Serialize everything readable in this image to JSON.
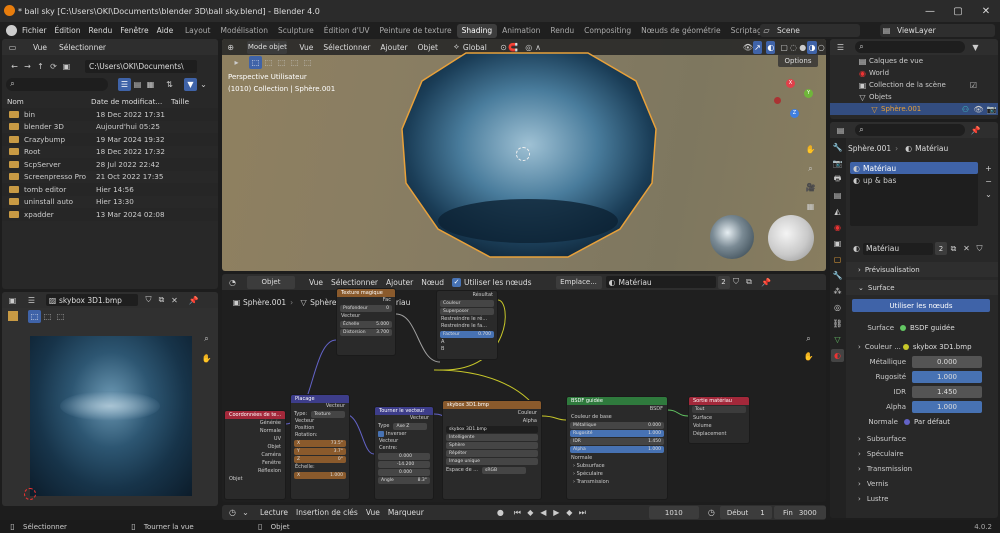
{
  "app": {
    "title": "* ball sky [C:\\Users\\OKI\\Documents\\blender 3D\\ball sky.blend] - Blender 4.0",
    "version": "4.0.2"
  },
  "menu": {
    "items": [
      "Fichier",
      "Édition",
      "Rendu",
      "Fenêtre",
      "Aide"
    ],
    "workspaces": [
      "Layout",
      "Modélisation",
      "Sculpture",
      "Édition d'UV",
      "Peinture de texture",
      "Shading",
      "Animation",
      "Rendu",
      "Compositing",
      "Nœuds de géométrie",
      "Scriptage"
    ],
    "active_workspace": "Shading",
    "scene": "Scene",
    "view_layer": "ViewLayer"
  },
  "file_browser": {
    "menu": [
      "Vue",
      "Sélectionner"
    ],
    "path": "C:\\Users\\OKI\\Documents\\",
    "columns": [
      "Nom",
      "Date de modificat...",
      "Taille"
    ],
    "files": [
      {
        "name": "bin",
        "date": "18 Dec 2022 17:31"
      },
      {
        "name": "blender 3D",
        "date": "Aujourd'hui 05:25"
      },
      {
        "name": "Crazybump",
        "date": "19 Mar 2024 19:32"
      },
      {
        "name": "Root",
        "date": "18 Dec 2022 17:32"
      },
      {
        "name": "ScpServer",
        "date": "28 Jul 2022 22:42"
      },
      {
        "name": "Screenpresso Pro",
        "date": "21 Oct 2022 17:35"
      },
      {
        "name": "tomb editor",
        "date": "Hier 14:56"
      },
      {
        "name": "uninstall auto",
        "date": "Hier 13:30"
      },
      {
        "name": "xpadder",
        "date": "13 Mar 2024 02:08"
      }
    ]
  },
  "image_editor": {
    "image_name": "skybox 3D1.bmp"
  },
  "viewport": {
    "mode": "Mode objet",
    "menu": [
      "Vue",
      "Sélectionner",
      "Ajouter",
      "Objet"
    ],
    "transform": "Global",
    "info_line1": "Perspective Utilisateur",
    "info_line2": "(1010) Collection | Sphère.001",
    "options": "Options",
    "axes": {
      "x": "X",
      "y": "Y",
      "z": "Z"
    }
  },
  "node_editor": {
    "type": "Objet",
    "menu": [
      "Vue",
      "Sélectionner",
      "Ajouter",
      "Nœud"
    ],
    "use_nodes_label": "Utiliser les nœuds",
    "slot": "Emplace...",
    "material": "Matériau",
    "users": "2",
    "breadcrumb": [
      "Sphère.001",
      "Sphère.001",
      "Matériau"
    ],
    "nodes": {
      "mix": {
        "out": "Résultat",
        "type": "Couleur",
        "blend": "Superposer",
        "clamp1": "Restreindre le ré...",
        "clamp2": "Restreindre le fa...",
        "factor_label": "Facteur",
        "factor": "0.700",
        "a": "A",
        "b": "B"
      },
      "magic": {
        "title": "Texture magique",
        "out": "Fac",
        "depth_label": "Profondeur",
        "depth": "0",
        "vec": "Vecteur",
        "scale_label": "Échelle",
        "scale": "5.000",
        "distortion_label": "Distorsion",
        "distortion": "3.700"
      },
      "coords": {
        "title": "Coordonnées de te...",
        "outs": [
          "Générée",
          "Normale",
          "UV",
          "Objet",
          "Caméra",
          "Fenêtre",
          "Réflexion"
        ],
        "object_label": "Objet"
      },
      "mapping": {
        "title": "Placage",
        "out": "Vecteur",
        "type_label": "Type:",
        "type": "Texture",
        "vec": "Vecteur",
        "position": "Position",
        "rotation": "Rotation:",
        "rx_label": "X",
        "rx": "73.5°",
        "ry_label": "Y",
        "ry": "3.7°",
        "rz_label": "Z",
        "rz": "0°",
        "scale": "Échelle:",
        "sx_label": "X",
        "sx": "1.000"
      },
      "rotate": {
        "title": "Tourner le vecteur",
        "out": "Vecteur",
        "type_label": "Type",
        "type": "Axe Z",
        "invert": "Inverser",
        "vec": "Vecteur",
        "center": "Centre:",
        "cx": "0.000",
        "cy": "-14.200",
        "cz": "0.000",
        "angle_label": "Angle",
        "angle": "8.3°"
      },
      "image": {
        "title": "skybox 3D1.bmp",
        "outs": [
          "Couleur",
          "Alpha"
        ],
        "img": "skybox 3D1.bmp",
        "interp": "Intelligente",
        "proj": "Sphère",
        "ext": "Répéter",
        "source": "Image unique",
        "cs_label": "Espace de ...",
        "cs": "sRGB"
      },
      "bsdf": {
        "title": "BSDF guidée",
        "out": "BSDF",
        "base": "Couleur de base",
        "metal_label": "Métallique",
        "metal": "0.000",
        "rough_label": "Rugosité",
        "rough": "1.000",
        "ior_label": "IDR",
        "ior": "1.450",
        "alpha_label": "Alpha",
        "alpha": "1.000",
        "normal": "Normale",
        "sub": "Subsurface",
        "spec": "Spéculaire",
        "trans": "Transmission"
      },
      "output": {
        "title": "Sortie matériau",
        "target": "Tout",
        "surface": "Surface",
        "volume": "Volume",
        "disp": "Déplacement"
      }
    }
  },
  "outliner": {
    "items": [
      {
        "label": "Calques de vue"
      },
      {
        "label": "World"
      },
      {
        "label": "Collection de la scène"
      },
      {
        "label": "Objets"
      },
      {
        "label": "Sphère.001"
      }
    ]
  },
  "properties": {
    "object": "Sphère.001",
    "material": "Matériau",
    "slots": [
      "Matériau",
      "up & bas"
    ],
    "mat_name": "Matériau",
    "mat_users": "2",
    "preview": "Prévisualisation",
    "surface_section": "Surface",
    "use_nodes": "Utiliser les nœuds",
    "surface_label": "Surface",
    "surface_value": "BSDF guidée",
    "color_label": "Couleur ...",
    "color_value": "skybox 3D1.bmp",
    "metal_label": "Métallique",
    "metal": "0.000",
    "rough_label": "Rugosité",
    "rough": "1.000",
    "ior_label": "IDR",
    "ior": "1.450",
    "alpha_label": "Alpha",
    "alpha": "1.000",
    "normal_label": "Normale",
    "normal_value": "Par défaut",
    "subsections": [
      "Subsurface",
      "Spéculaire",
      "Transmission",
      "Vernis",
      "Lustre"
    ]
  },
  "timeline": {
    "menu": [
      "Lecture",
      "Insertion de clés",
      "Vue",
      "Marqueur"
    ],
    "current_frame": "1010",
    "start_label": "Début",
    "start": "1",
    "end_label": "Fin",
    "end": "3000"
  },
  "statusbar": {
    "select": "Sélectionner",
    "rotate": "Tourner la vue",
    "object": "Objet"
  }
}
